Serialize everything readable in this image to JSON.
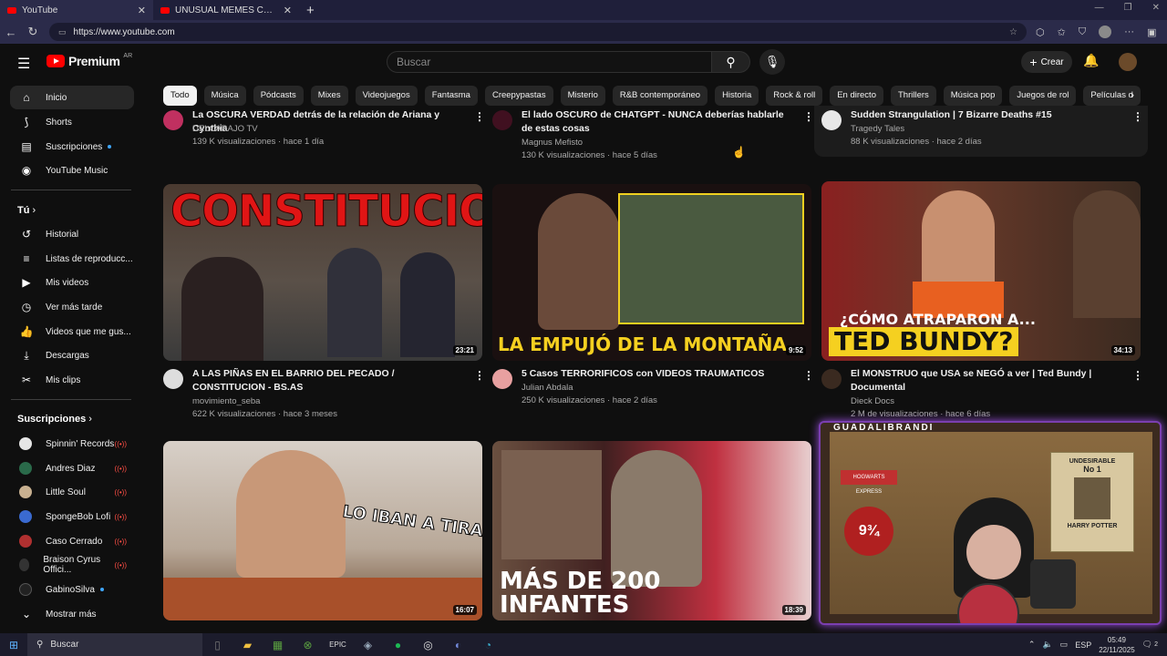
{
  "browser": {
    "tabs": [
      {
        "label": "YouTube",
        "active": true
      },
      {
        "label": "UNUSUAL MEMES COMPILATION",
        "active": false
      }
    ],
    "url": "https://www.youtube.com"
  },
  "header": {
    "logo_text": "Premium",
    "country": "AR",
    "search_placeholder": "Buscar",
    "create_label": "Crear"
  },
  "sidebar": {
    "main": [
      {
        "label": "Inicio",
        "icon": "home-icon"
      },
      {
        "label": "Shorts",
        "icon": "shorts-icon"
      },
      {
        "label": "Suscripciones",
        "icon": "subscriptions-icon"
      },
      {
        "label": "YouTube Music",
        "icon": "music-icon"
      }
    ],
    "you_heading": "Tú",
    "you": [
      {
        "label": "Historial",
        "icon": "history-icon"
      },
      {
        "label": "Listas de reproducc...",
        "icon": "playlist-icon"
      },
      {
        "label": "Mis videos",
        "icon": "my-videos-icon"
      },
      {
        "label": "Ver más tarde",
        "icon": "clock-icon"
      },
      {
        "label": "Videos que me gus...",
        "icon": "thumbs-up-icon"
      },
      {
        "label": "Descargas",
        "icon": "download-icon"
      },
      {
        "label": "Mis clips",
        "icon": "scissors-icon"
      }
    ],
    "subs_heading": "Suscripciones",
    "subs": [
      {
        "label": "Spinnin' Records",
        "color": "#e6e6e6",
        "live": true
      },
      {
        "label": "Andres Diaz",
        "color": "#2a6a4a",
        "live": true
      },
      {
        "label": "Little Soul",
        "color": "#c8b090",
        "live": true
      },
      {
        "label": "SpongeBob Lofi",
        "color": "#3a6ad0",
        "live": true
      },
      {
        "label": "Caso Cerrado",
        "color": "#b03030",
        "live": true
      },
      {
        "label": "Braison Cyrus Offici...",
        "color": "#333333",
        "live": true
      },
      {
        "label": "GabinoSilva",
        "color": "#222222",
        "live": false
      }
    ],
    "more_label": "Mostrar más"
  },
  "chips": [
    "Todo",
    "Música",
    "Pódcasts",
    "Mixes",
    "Videojuegos",
    "Fantasma",
    "Creepypastas",
    "Misterio",
    "R&B contemporáneo",
    "Historia",
    "Rock & roll",
    "En directo",
    "Thrillers",
    "Música pop",
    "Juegos de rol",
    "Películas d"
  ],
  "top_row": [
    {
      "title": "La OSCURA VERDAD detrás de la relación de Ariana y Cynthia",
      "channel": "DELCARAJO TV",
      "meta": "139 K visualizaciones · hace 1 día"
    },
    {
      "title": "El lado OSCURO de CHATGPT - NUNCA deberías hablarle de estas cosas",
      "channel": "Magnus Mefisto",
      "meta": "130 K visualizaciones · hace 5 días"
    },
    {
      "title": "Sudden Strangulation | 7 Bizarre Deaths #15",
      "channel": "Tragedy Tales",
      "meta": "88 K visualizaciones · hace 2 días"
    }
  ],
  "mid_row": [
    {
      "title": "A LAS PIÑAS EN EL BARRIO DEL PECADO / CONSTITUCION - BS.AS",
      "channel": "movimiento_seba",
      "meta": "622 K visualizaciones · hace 3 meses",
      "duration": "23:21",
      "thumb_text": "CONSTITUCION"
    },
    {
      "title": "5 Casos TERRORIFICOS con VIDEOS TRAUMATICOS",
      "channel": "Julian Abdala",
      "meta": "250 K visualizaciones · hace 2 días",
      "duration": "9:52",
      "thumb_text": "LA EMPUJÓ DE LA MONTAÑA"
    },
    {
      "title": "El MONSTRUO que USA se NEGÓ a ver | Ted Bundy | Documental",
      "channel": "Dieck Docs",
      "meta": "2 M de visualizaciones · hace 6 días",
      "duration": "34:13",
      "thumb_text_1": "¿CÓMO ATRAPARON A...",
      "thumb_text_2": "TED BUNDY?"
    }
  ],
  "bottom_row": [
    {
      "duration": "16:07",
      "thumb_text": "LO IBAN A TIRAR!!"
    },
    {
      "duration": "18:39",
      "thumb_text_1": "MÁS DE 200",
      "thumb_text_2": "INFANTES"
    }
  ],
  "stream": {
    "name": "GUADALIBRANDI",
    "poster_title": "UNDESIRABLE",
    "poster_sub": "No 1",
    "poster_name": "HARRY POTTER",
    "platform": "9¾",
    "hogwarts": "HOGWARTS EXPRESS"
  },
  "taskbar": {
    "search": "Buscar",
    "lang": "ESP",
    "time": "05:49",
    "date": "22/11/2025",
    "notif": "2"
  }
}
